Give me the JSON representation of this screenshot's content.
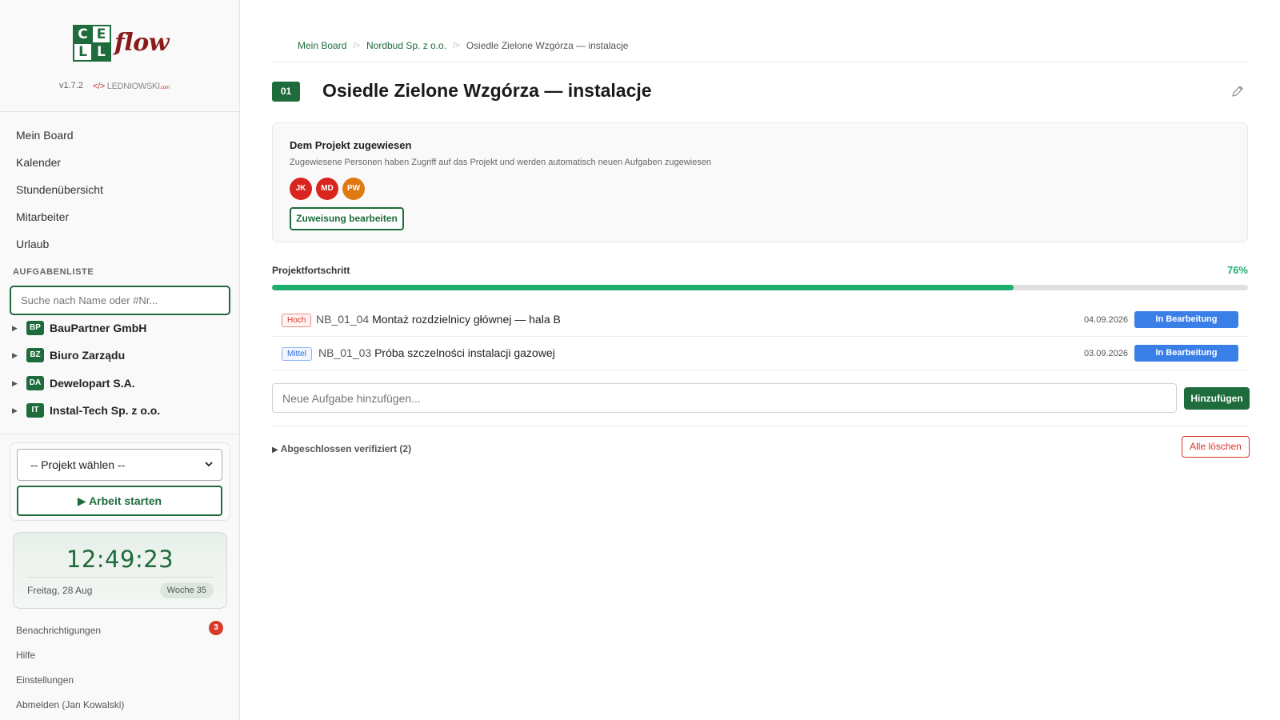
{
  "app": {
    "logo_letters": [
      "C",
      "E",
      "L",
      "L"
    ],
    "logo_word": "flow",
    "version": "v1.7.2",
    "vendor_prefix": "</>",
    "vendor": "LEDNIOWSKI",
    "vendor_domain": ".com"
  },
  "sidebar": {
    "nav": [
      "Mein Board",
      "Kalender",
      "Stundenübersicht",
      "Mitarbeiter",
      "Urlaub"
    ],
    "section_label": "AUFGABENLISTE",
    "search_placeholder": "Suche nach Name oder #Nr...",
    "clients": [
      {
        "badge": "BP",
        "name": "BauPartner GmbH"
      },
      {
        "badge": "BZ",
        "name": "Biuro Zarządu"
      },
      {
        "badge": "DA",
        "name": "Dewelopart S.A."
      },
      {
        "badge": "IT",
        "name": "Instal-Tech Sp. z o.o."
      }
    ],
    "project_select": "-- Projekt wählen --",
    "start_button": "Arbeit starten",
    "clock": {
      "time": "12:49:23",
      "date": "Freitag, 28 Aug",
      "week": "Woche 35"
    },
    "footer": {
      "notifications": "Benachrichtigungen",
      "notifications_count": "3",
      "help": "Hilfe",
      "settings": "Einstellungen",
      "logout": "Abmelden (Jan Kowalski)"
    }
  },
  "breadcrumb": [
    "Mein Board",
    "Nordbud Sp. z o.o.",
    "Osiedle Zielone Wzgórza — instalacje"
  ],
  "breadcrumb_sep": "/>",
  "project": {
    "number": "01",
    "title": "Osiedle Zielone Wzgórza — instalacje"
  },
  "assignment": {
    "title": "Dem Projekt zugewiesen",
    "description": "Zugewiesene Personen haben Zugriff auf das Projekt und werden automatisch neuen Aufgaben zugewiesen",
    "people": [
      {
        "initials": "JK",
        "color": "#d9251d"
      },
      {
        "initials": "MD",
        "color": "#d9251d"
      },
      {
        "initials": "PW",
        "color": "#e07a10"
      }
    ],
    "edit_button": "Zuweisung bearbeiten"
  },
  "progress": {
    "label": "Projektfortschritt",
    "percent_text": "76%",
    "value": 76
  },
  "tasks": [
    {
      "priority": "Hoch",
      "code": "NB_01_04",
      "name": "Montaż rozdzielnicy głównej — hala B",
      "date": "04.09.2026",
      "status": "In Bearbeitung"
    },
    {
      "priority": "Mittel",
      "code": "NB_01_03",
      "name": "Próba szczelności instalacji gazowej",
      "date": "03.09.2026",
      "status": "In Bearbeitung"
    }
  ],
  "new_task": {
    "placeholder": "Neue Aufgabe hinzufügen...",
    "button": "Hinzufügen"
  },
  "completed": {
    "label": "Abgeschlossen verifiziert (2)",
    "clear_button": "Alle löschen"
  },
  "colors": {
    "brand": "#1e6b3c",
    "progress": "#1fae6e",
    "status": "#3a7fe8",
    "danger": "#d9342b"
  }
}
